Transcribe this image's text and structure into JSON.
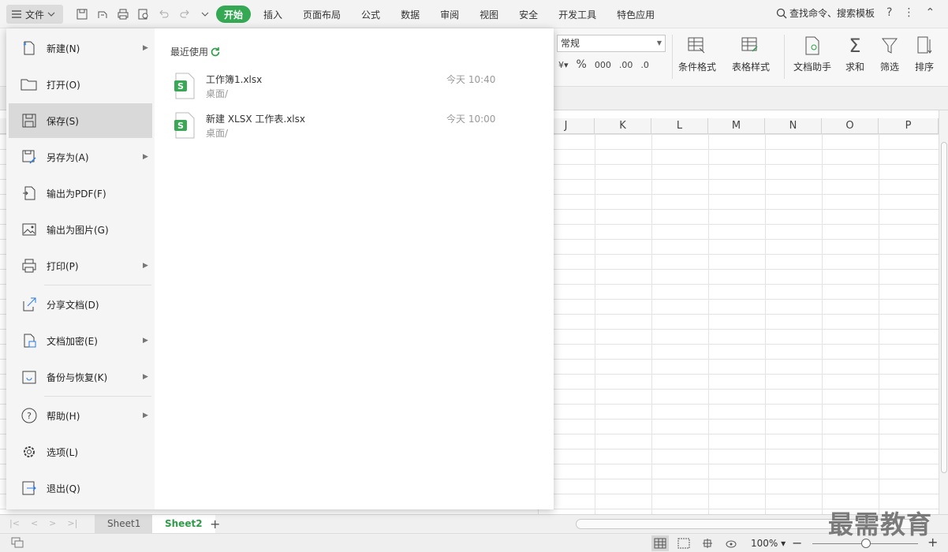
{
  "topbar": {
    "file_label": "文件",
    "tabs": [
      {
        "label": "开始",
        "active": true
      },
      {
        "label": "插入"
      },
      {
        "label": "页面布局"
      },
      {
        "label": "公式"
      },
      {
        "label": "数据"
      },
      {
        "label": "审阅"
      },
      {
        "label": "视图"
      },
      {
        "label": "安全"
      },
      {
        "label": "开发工具"
      },
      {
        "label": "特色应用"
      }
    ],
    "search_label": "查找命令、搜索模板",
    "accent": "#34a853"
  },
  "ribbon": {
    "number_format": "常规",
    "cond_format": "条件格式",
    "table_style": "表格样式",
    "doc_helper": "文档助手",
    "sum": "求和",
    "filter": "筛选",
    "sort": "排序"
  },
  "grid": {
    "columns": [
      "J",
      "K",
      "L",
      "M",
      "N",
      "O",
      "P"
    ]
  },
  "backstage": {
    "menu": [
      {
        "label": "新建(N)",
        "icon": "new-file-icon",
        "arrow": true
      },
      {
        "label": "打开(O)",
        "icon": "folder-open-icon",
        "arrow": false
      },
      {
        "label": "保存(S)",
        "icon": "save-icon",
        "arrow": false,
        "selected": true
      },
      {
        "label": "另存为(A)",
        "icon": "save-as-icon",
        "arrow": true
      },
      {
        "label": "输出为PDF(F)",
        "icon": "pdf-export-icon",
        "arrow": false
      },
      {
        "label": "输出为图片(G)",
        "icon": "image-export-icon",
        "arrow": false
      },
      {
        "label": "打印(P)",
        "icon": "printer-icon",
        "arrow": true
      },
      {
        "label": "分享文档(D)",
        "icon": "share-icon",
        "arrow": false
      },
      {
        "label": "文档加密(E)",
        "icon": "encrypt-icon",
        "arrow": true
      },
      {
        "label": "备份与恢复(K)",
        "icon": "backup-icon",
        "arrow": true
      },
      {
        "label": "帮助(H)",
        "icon": "help-icon",
        "arrow": true
      },
      {
        "label": "选项(L)",
        "icon": "gear-icon",
        "arrow": false
      },
      {
        "label": "退出(Q)",
        "icon": "exit-icon",
        "arrow": false
      }
    ],
    "recent_title": "最近使用",
    "recent_files": [
      {
        "name": "工作簿1.xlsx",
        "path": "桌面/",
        "time": "今天 10:40"
      },
      {
        "name": "新建 XLSX 工作表.xlsx",
        "path": "桌面/",
        "time": "今天 10:00"
      }
    ]
  },
  "sheets": {
    "tabs": [
      "Sheet1",
      "Sheet2"
    ],
    "active": "Sheet2"
  },
  "status": {
    "zoom": "100%"
  },
  "watermark": "最需教育"
}
